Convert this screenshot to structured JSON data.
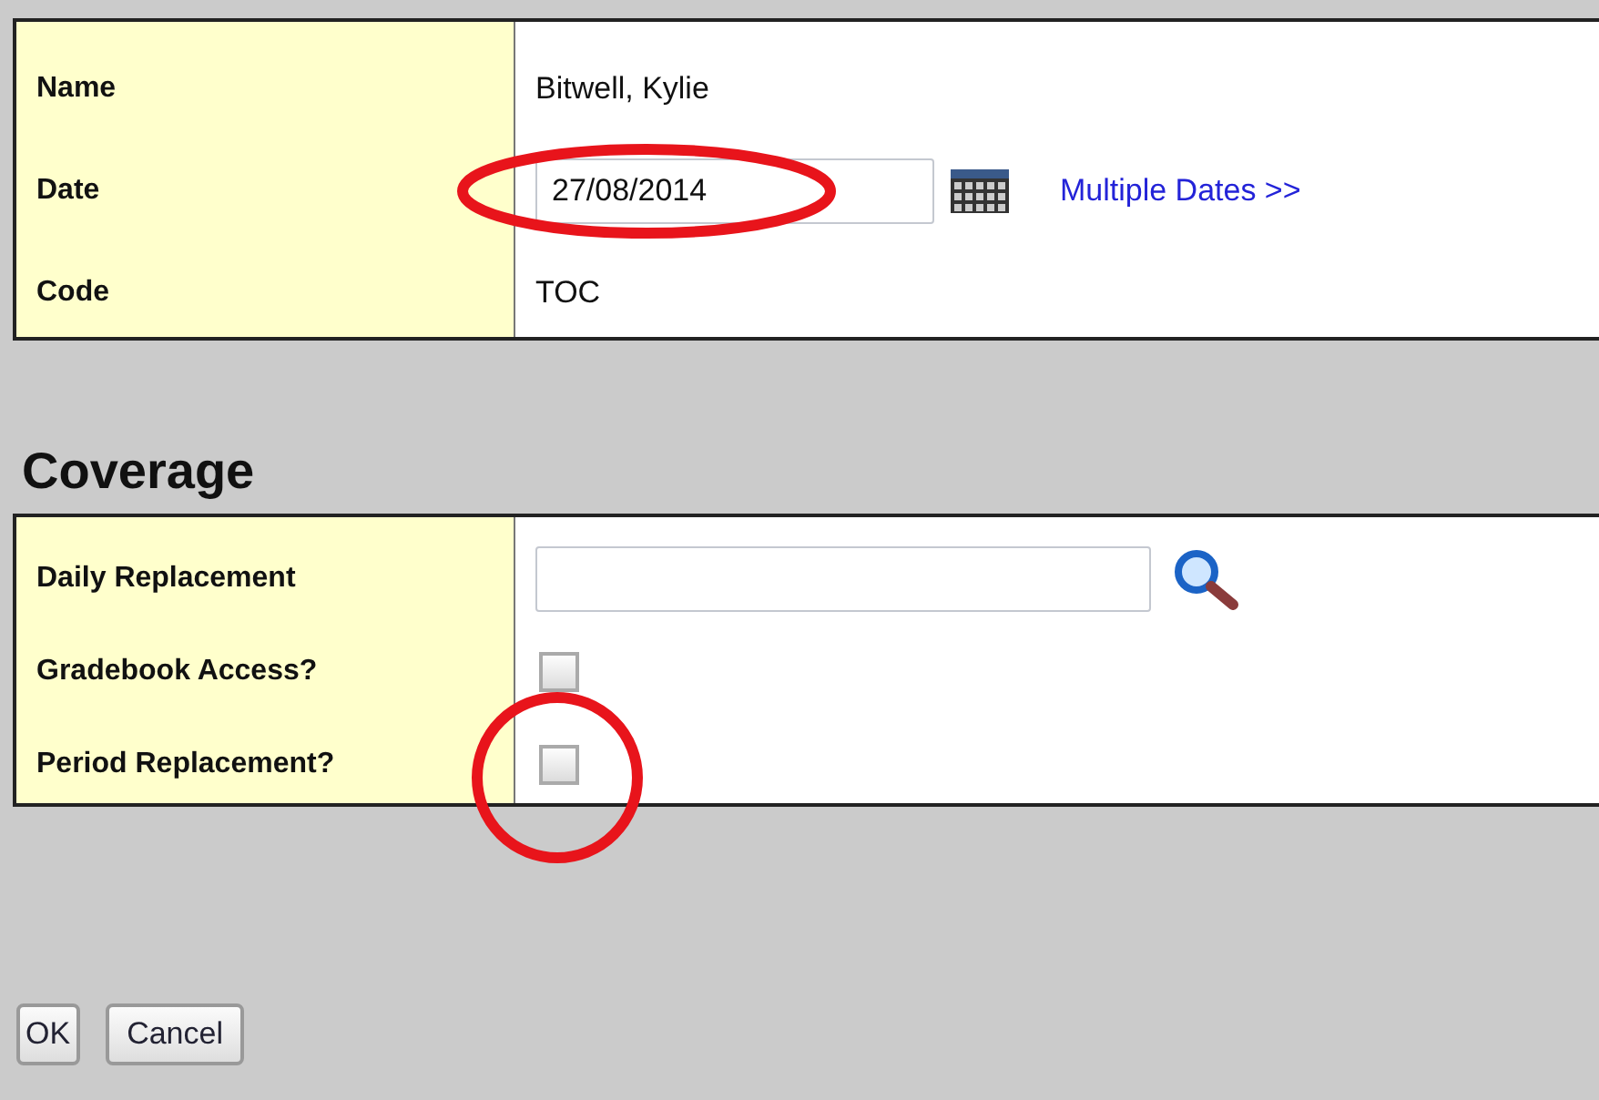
{
  "details": {
    "rows": [
      {
        "kind": "text",
        "label": "Name",
        "value": "Bitwell, Kylie"
      },
      {
        "kind": "date",
        "label": "Date",
        "value": "27/08/2014",
        "circled": true,
        "link": "Multiple Dates >>"
      },
      {
        "kind": "text",
        "label": "Code",
        "value": "TOC"
      }
    ]
  },
  "coverage": {
    "heading": "Coverage",
    "rows": [
      {
        "kind": "lookup",
        "label": "Daily Replacement",
        "value": ""
      },
      {
        "kind": "checkbox",
        "label": "Gradebook Access?",
        "checked": false,
        "circled": false
      },
      {
        "kind": "checkbox",
        "label": "Period Replacement?",
        "checked": false,
        "circled": true
      }
    ]
  },
  "buttons": [
    "OK",
    "Cancel"
  ]
}
